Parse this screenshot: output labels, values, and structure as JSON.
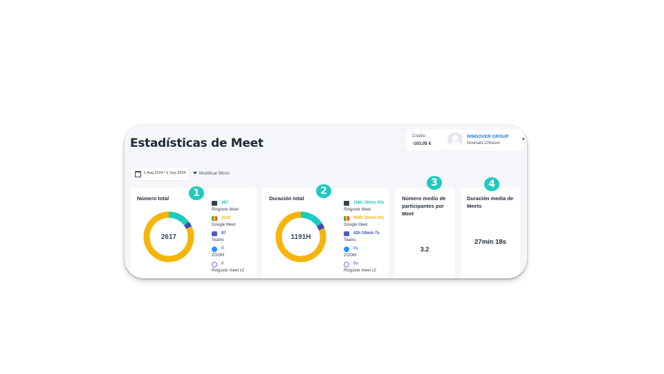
{
  "header": {
    "title": "Estadísticas de Meet",
    "credit_label": "Crédito",
    "credit_value": "-103,05 €",
    "company": "RINGOVER GROUP",
    "user_name": "Nouhaila Chliouet"
  },
  "toolbar": {
    "date_range": "1 Aug 2024 / 5 Sep 2024",
    "filters_label": "Modificar filtros"
  },
  "cards": {
    "total_number": {
      "title": "Número total",
      "center": "2617",
      "legend": [
        {
          "value": "387",
          "name": "Ringover Meet",
          "color": "#1ec9c0",
          "icon": "video-camera-icon"
        },
        {
          "value": "2143",
          "name": "Google Meet",
          "color": "#f5b50a",
          "icon": "google-meet-icon"
        },
        {
          "value": "87",
          "name": "Teams",
          "color": "#3f4bb5",
          "icon": "teams-icon"
        },
        {
          "value": "0",
          "name": "ZOOM",
          "color": "#2d8cff",
          "icon": "zoom-icon"
        },
        {
          "value": "0",
          "name": "Ringover meet v2",
          "color": "#8b5cf6",
          "icon": "ringover-v2-icon"
        }
      ]
    },
    "total_duration": {
      "title": "Duración total",
      "center": "1191H",
      "legend": [
        {
          "value": "188h 18min 43s",
          "name": "Ringover Meet",
          "color": "#1ec9c0",
          "icon": "video-camera-icon"
        },
        {
          "value": "960h 32min 33s",
          "name": "Google Meet",
          "color": "#f5b50a",
          "icon": "google-meet-icon"
        },
        {
          "value": "42h 19min 7s",
          "name": "Teams",
          "color": "#3f4bb5",
          "icon": "teams-icon"
        },
        {
          "value": "0s",
          "name": "ZOOM",
          "color": "#2d8cff",
          "icon": "zoom-icon"
        },
        {
          "value": "0s",
          "name": "Ringover meet v2",
          "color": "#8b5cf6",
          "icon": "ringover-v2-icon"
        }
      ]
    },
    "avg_participants": {
      "title": "Número medio de participantes por Meet",
      "value": "3.2"
    },
    "avg_duration": {
      "title": "Duración media de Meets",
      "value": "27min 18s"
    }
  },
  "badges": [
    "1",
    "2",
    "3",
    "4"
  ],
  "chart_data": [
    {
      "type": "pie",
      "categories": [
        "Ringover Meet",
        "Google Meet",
        "Teams",
        "ZOOM",
        "Ringover meet v2"
      ],
      "values": [
        387,
        2143,
        87,
        0,
        0
      ],
      "colors": [
        "#1ec9c0",
        "#f5b50a",
        "#3f4bb5",
        "#2d8cff",
        "#8b5cf6"
      ]
    },
    {
      "type": "pie",
      "categories": [
        "Ringover Meet",
        "Google Meet",
        "Teams",
        "ZOOM",
        "Ringover meet v2"
      ],
      "values": [
        188.31,
        960.54,
        42.32,
        0,
        0
      ],
      "colors": [
        "#1ec9c0",
        "#f5b50a",
        "#3f4bb5",
        "#2d8cff",
        "#8b5cf6"
      ]
    }
  ]
}
